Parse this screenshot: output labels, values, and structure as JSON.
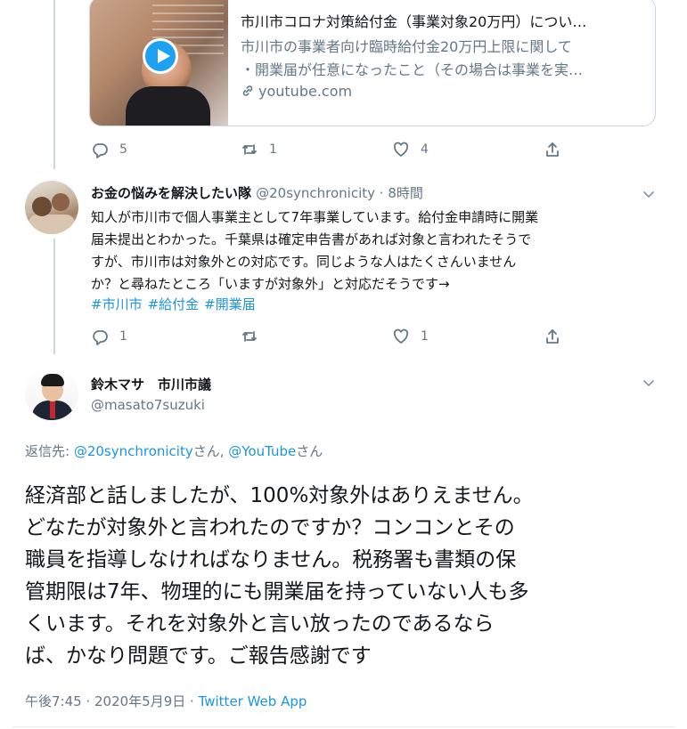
{
  "card": {
    "title": "市川市コロナ対策給付金（事業対象20万円）につい…",
    "description_lines": [
      "市川市の事業者向け臨時給付金20万円上限に関して",
      "・開業届が任意になったこと（その場合は事業を実…"
    ],
    "domain": "youtube.com",
    "link_icon": "link-icon",
    "play_icon": "play-icon"
  },
  "tweet1_actions": {
    "reply_count": "5",
    "retweet_count": "1",
    "like_count": "4"
  },
  "tweet2": {
    "name": "お金の悩みを解決したい隊",
    "handle": "@20synchronicity",
    "separator": " · ",
    "time": "8時間",
    "lines": [
      "知人が市川市で個人事業主として7年事業しています。給付金申請時に開業",
      "届未提出とわかった。千葉県は確定申告書があれば対象と言われたそうで",
      "すが、市川市は対象外との対応です。同じような人はたくさんいません",
      "か？と尋ねたところ「いますが対象外」と対応だそうです→"
    ],
    "hashtags": [
      "#市川市",
      "#給付金",
      "#開業届"
    ],
    "actions": {
      "reply_count": "1",
      "retweet_count": "",
      "like_count": "1"
    }
  },
  "tweet3": {
    "name": "鈴木マサ　市川市議",
    "handle": "@masato7suzuki",
    "reply_prefix": "返信先: ",
    "reply_user1": "@20synchronicity",
    "reply_suffix1": "さん, ",
    "reply_user2": "@YouTube",
    "reply_suffix2": "さん",
    "lines": [
      "経済部と話しましたが、100%対象外はありえません。",
      "どなたが対象外と言われたのですか？コンコンとその",
      "職員を指導しなければなりません。税務署も書類の保",
      "管期限は7年、物理的にも開業届を持っていない人も多",
      "くいます。それを対象外と言い放ったのであるなら",
      "ば、かなり問題です。ご報告感謝です"
    ],
    "timestamp": "午後7:45 · 2020年5月9日 · ",
    "source": "Twitter Web App"
  },
  "colors": {
    "link": "#1b95e0",
    "secondary": "#657786",
    "border": "#ccd6dd",
    "play": "#1da1f2"
  }
}
